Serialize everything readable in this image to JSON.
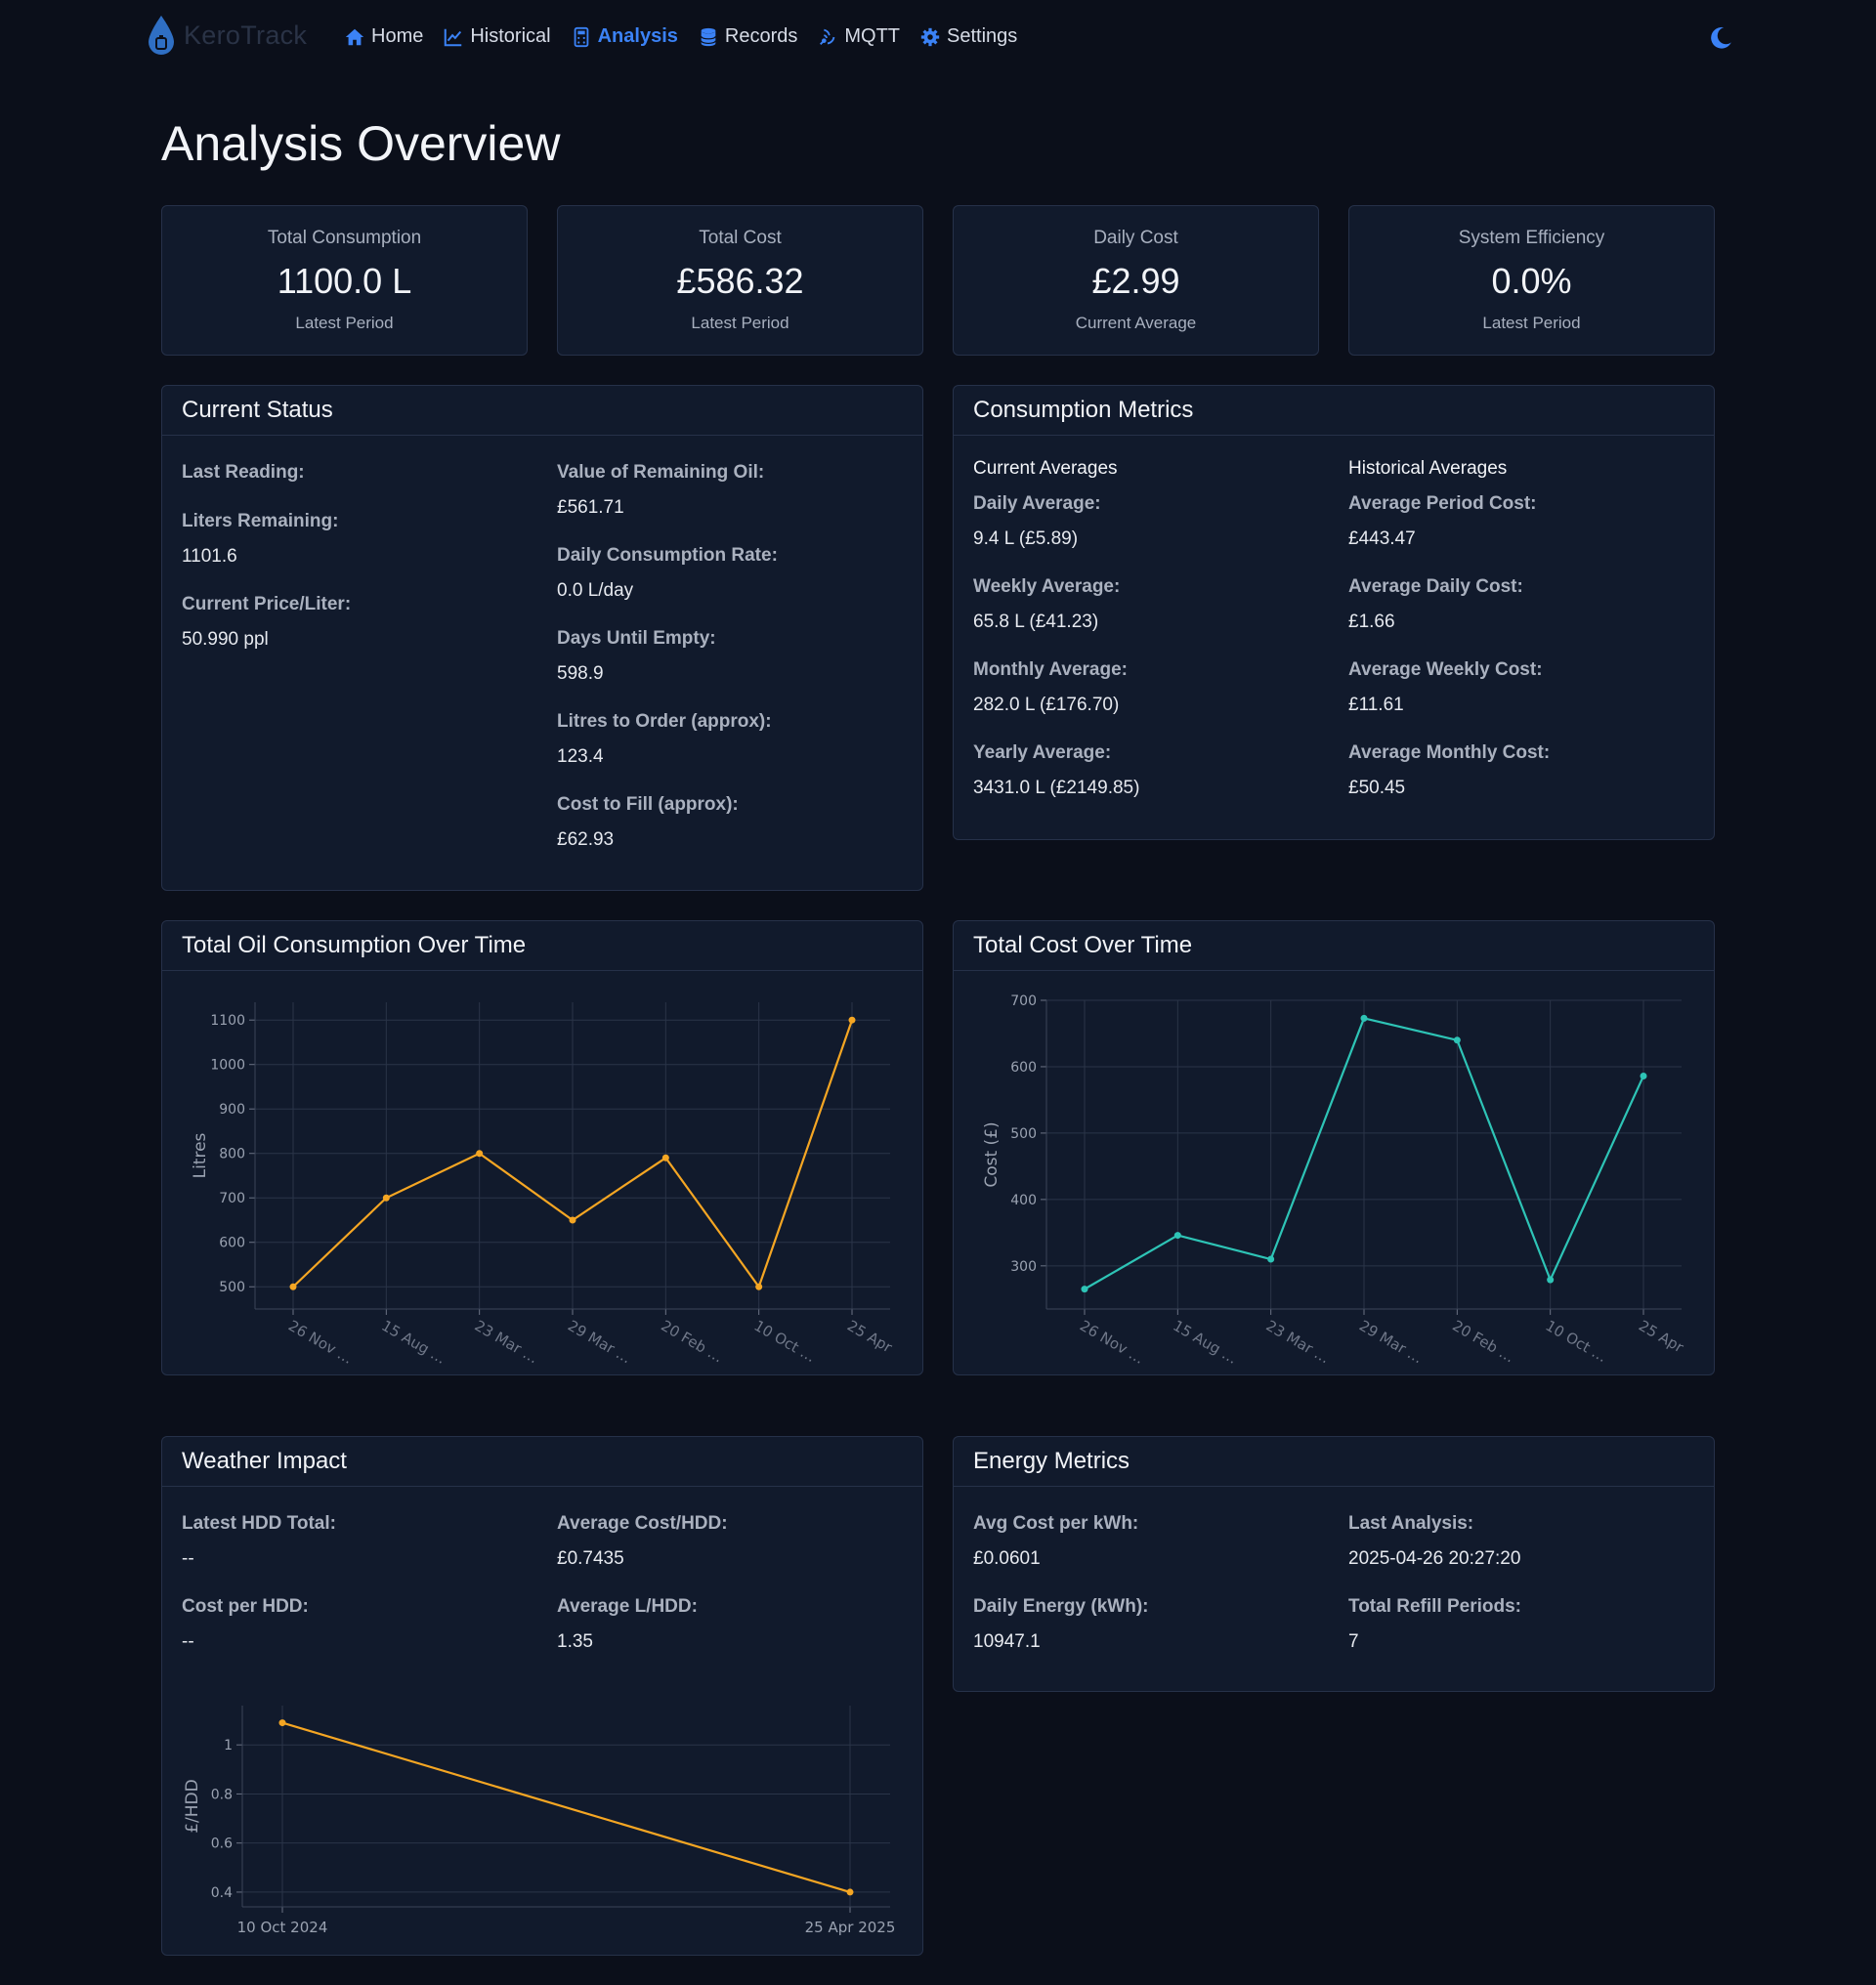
{
  "nav": {
    "brand": "KeroTrack",
    "links": [
      {
        "label": "Home",
        "icon": "home-icon"
      },
      {
        "label": "Historical",
        "icon": "chart-line-icon"
      },
      {
        "label": "Analysis",
        "icon": "calculator-icon",
        "active": true
      },
      {
        "label": "Records",
        "icon": "database-icon"
      },
      {
        "label": "MQTT",
        "icon": "broadcast-icon"
      },
      {
        "label": "Settings",
        "icon": "gear-icon"
      }
    ],
    "theme_icon": "moon-icon"
  },
  "page_title": "Analysis Overview",
  "stats": [
    {
      "label": "Total Consumption",
      "value": "1100.0 L",
      "sub": "Latest Period"
    },
    {
      "label": "Total Cost",
      "value": "£586.32",
      "sub": "Latest Period"
    },
    {
      "label": "Daily Cost",
      "value": "£2.99",
      "sub": "Current Average"
    },
    {
      "label": "System Efficiency",
      "value": "0.0%",
      "sub": "Latest Period"
    }
  ],
  "current_status": {
    "title": "Current Status",
    "last_reading": {
      "k": "Last Reading:"
    },
    "liters_remaining": {
      "k": "Liters Remaining:",
      "v": "1101.6"
    },
    "price_per_liter": {
      "k": "Current Price/Liter:",
      "v": "50.990 ppl"
    },
    "value_remaining": {
      "k": "Value of Remaining Oil:",
      "v": "£561.71"
    },
    "daily_rate": {
      "k": "Daily Consumption Rate:",
      "v": "0.0 L/day"
    },
    "days_until_empty": {
      "k": "Days Until Empty:",
      "v": "598.9"
    },
    "litres_to_order": {
      "k": "Litres to Order (approx):",
      "v": "123.4"
    },
    "cost_to_fill": {
      "k": "Cost to Fill (approx):",
      "v": "£62.93"
    }
  },
  "consumption_metrics": {
    "title": "Consumption Metrics",
    "current_title": "Current Averages",
    "historical_title": "Historical Averages",
    "current": [
      {
        "k": "Daily Average:",
        "v": "9.4 L (£5.89)"
      },
      {
        "k": "Weekly Average:",
        "v": "65.8 L (£41.23)"
      },
      {
        "k": "Monthly Average:",
        "v": "282.0 L (£176.70)"
      },
      {
        "k": "Yearly Average:",
        "v": "3431.0 L (£2149.85)"
      }
    ],
    "historical": [
      {
        "k": "Average Period Cost:",
        "v": "£443.47"
      },
      {
        "k": "Average Daily Cost:",
        "v": "£1.66"
      },
      {
        "k": "Average Weekly Cost:",
        "v": "£11.61"
      },
      {
        "k": "Average Monthly Cost:",
        "v": "£50.45"
      }
    ]
  },
  "consumption_chart": {
    "title": "Total Oil Consumption Over Time"
  },
  "cost_chart": {
    "title": "Total Cost Over Time"
  },
  "weather": {
    "title": "Weather Impact",
    "latest_hdd": {
      "k": "Latest HDD Total:",
      "v": "--"
    },
    "cost_per_hdd": {
      "k": "Cost per HDD:",
      "v": "--"
    },
    "avg_cost_hdd": {
      "k": "Average Cost/HDD:",
      "v": "£0.7435"
    },
    "avg_l_hdd": {
      "k": "Average L/HDD:",
      "v": "1.35"
    }
  },
  "energy": {
    "title": "Energy Metrics",
    "avg_cost_kwh": {
      "k": "Avg Cost per kWh:",
      "v": "£0.0601"
    },
    "daily_energy": {
      "k": "Daily Energy (kWh):",
      "v": "10947.1"
    },
    "last_analysis": {
      "k": "Last Analysis:",
      "v": "2025-04-26 20:27:20"
    },
    "refill_periods": {
      "k": "Total Refill Periods:",
      "v": "7"
    }
  },
  "colors": {
    "accent": "#3b82f6",
    "orange": "#f5a623",
    "teal": "#2ec4b6"
  },
  "chart_data": [
    {
      "type": "line",
      "title": "Total Oil Consumption Over Time",
      "xlabel": "",
      "ylabel": "Litres",
      "categories": [
        "26 Nov …",
        "15 Aug …",
        "23 Mar …",
        "29 Mar …",
        "20 Feb …",
        "10 Oct …",
        "25 Apr"
      ],
      "values": [
        500,
        700,
        800,
        650,
        790,
        500,
        1100
      ],
      "ylim": [
        450,
        1140
      ],
      "yticks": [
        500,
        600,
        700,
        800,
        900,
        1000,
        1100
      ],
      "grid": true
    },
    {
      "type": "line",
      "title": "Total Cost Over Time",
      "xlabel": "",
      "ylabel": "Cost (£)",
      "categories": [
        "26 Nov …",
        "15 Aug …",
        "23 Mar …",
        "29 Mar …",
        "20 Feb …",
        "10 Oct …",
        "25 Apr"
      ],
      "values": [
        265,
        346,
        310,
        673,
        640,
        279,
        586
      ],
      "ylim": [
        235,
        700
      ],
      "yticks": [
        300,
        400,
        500,
        600,
        700
      ],
      "grid": true
    },
    {
      "type": "line",
      "title": "",
      "xlabel": "",
      "ylabel": "£/HDD",
      "categories": [
        "10 Oct 2024",
        "25 Apr 2025"
      ],
      "values": [
        1.09,
        0.4
      ],
      "ylim": [
        0.34,
        1.16
      ],
      "yticks": [
        0.4,
        0.6,
        0.8,
        1
      ],
      "grid": true
    }
  ]
}
